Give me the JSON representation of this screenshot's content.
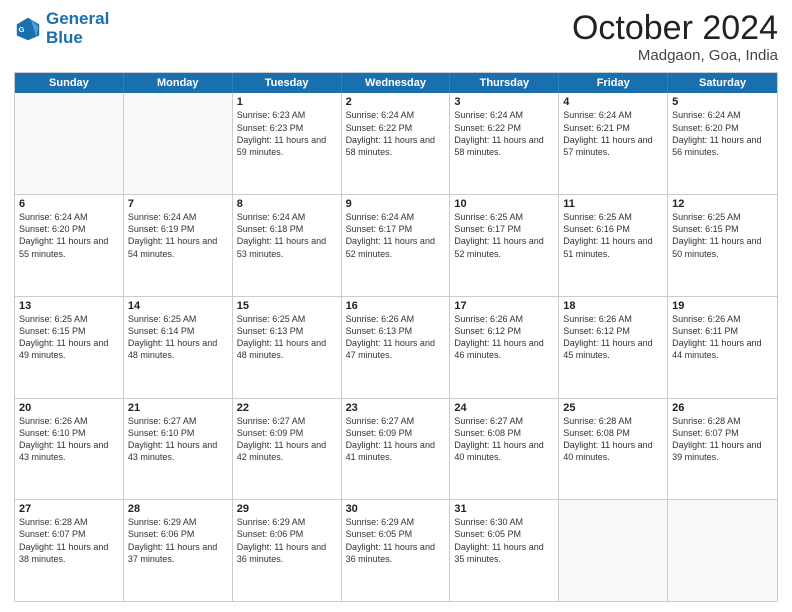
{
  "header": {
    "logo_line1": "General",
    "logo_line2": "Blue",
    "month_title": "October 2024",
    "subtitle": "Madgaon, Goa, India"
  },
  "weekdays": [
    "Sunday",
    "Monday",
    "Tuesday",
    "Wednesday",
    "Thursday",
    "Friday",
    "Saturday"
  ],
  "rows": [
    [
      {
        "day": "",
        "sunrise": "",
        "sunset": "",
        "daylight": ""
      },
      {
        "day": "",
        "sunrise": "",
        "sunset": "",
        "daylight": ""
      },
      {
        "day": "1",
        "sunrise": "Sunrise: 6:23 AM",
        "sunset": "Sunset: 6:23 PM",
        "daylight": "Daylight: 11 hours and 59 minutes."
      },
      {
        "day": "2",
        "sunrise": "Sunrise: 6:24 AM",
        "sunset": "Sunset: 6:22 PM",
        "daylight": "Daylight: 11 hours and 58 minutes."
      },
      {
        "day": "3",
        "sunrise": "Sunrise: 6:24 AM",
        "sunset": "Sunset: 6:22 PM",
        "daylight": "Daylight: 11 hours and 58 minutes."
      },
      {
        "day": "4",
        "sunrise": "Sunrise: 6:24 AM",
        "sunset": "Sunset: 6:21 PM",
        "daylight": "Daylight: 11 hours and 57 minutes."
      },
      {
        "day": "5",
        "sunrise": "Sunrise: 6:24 AM",
        "sunset": "Sunset: 6:20 PM",
        "daylight": "Daylight: 11 hours and 56 minutes."
      }
    ],
    [
      {
        "day": "6",
        "sunrise": "Sunrise: 6:24 AM",
        "sunset": "Sunset: 6:20 PM",
        "daylight": "Daylight: 11 hours and 55 minutes."
      },
      {
        "day": "7",
        "sunrise": "Sunrise: 6:24 AM",
        "sunset": "Sunset: 6:19 PM",
        "daylight": "Daylight: 11 hours and 54 minutes."
      },
      {
        "day": "8",
        "sunrise": "Sunrise: 6:24 AM",
        "sunset": "Sunset: 6:18 PM",
        "daylight": "Daylight: 11 hours and 53 minutes."
      },
      {
        "day": "9",
        "sunrise": "Sunrise: 6:24 AM",
        "sunset": "Sunset: 6:17 PM",
        "daylight": "Daylight: 11 hours and 52 minutes."
      },
      {
        "day": "10",
        "sunrise": "Sunrise: 6:25 AM",
        "sunset": "Sunset: 6:17 PM",
        "daylight": "Daylight: 11 hours and 52 minutes."
      },
      {
        "day": "11",
        "sunrise": "Sunrise: 6:25 AM",
        "sunset": "Sunset: 6:16 PM",
        "daylight": "Daylight: 11 hours and 51 minutes."
      },
      {
        "day": "12",
        "sunrise": "Sunrise: 6:25 AM",
        "sunset": "Sunset: 6:15 PM",
        "daylight": "Daylight: 11 hours and 50 minutes."
      }
    ],
    [
      {
        "day": "13",
        "sunrise": "Sunrise: 6:25 AM",
        "sunset": "Sunset: 6:15 PM",
        "daylight": "Daylight: 11 hours and 49 minutes."
      },
      {
        "day": "14",
        "sunrise": "Sunrise: 6:25 AM",
        "sunset": "Sunset: 6:14 PM",
        "daylight": "Daylight: 11 hours and 48 minutes."
      },
      {
        "day": "15",
        "sunrise": "Sunrise: 6:25 AM",
        "sunset": "Sunset: 6:13 PM",
        "daylight": "Daylight: 11 hours and 48 minutes."
      },
      {
        "day": "16",
        "sunrise": "Sunrise: 6:26 AM",
        "sunset": "Sunset: 6:13 PM",
        "daylight": "Daylight: 11 hours and 47 minutes."
      },
      {
        "day": "17",
        "sunrise": "Sunrise: 6:26 AM",
        "sunset": "Sunset: 6:12 PM",
        "daylight": "Daylight: 11 hours and 46 minutes."
      },
      {
        "day": "18",
        "sunrise": "Sunrise: 6:26 AM",
        "sunset": "Sunset: 6:12 PM",
        "daylight": "Daylight: 11 hours and 45 minutes."
      },
      {
        "day": "19",
        "sunrise": "Sunrise: 6:26 AM",
        "sunset": "Sunset: 6:11 PM",
        "daylight": "Daylight: 11 hours and 44 minutes."
      }
    ],
    [
      {
        "day": "20",
        "sunrise": "Sunrise: 6:26 AM",
        "sunset": "Sunset: 6:10 PM",
        "daylight": "Daylight: 11 hours and 43 minutes."
      },
      {
        "day": "21",
        "sunrise": "Sunrise: 6:27 AM",
        "sunset": "Sunset: 6:10 PM",
        "daylight": "Daylight: 11 hours and 43 minutes."
      },
      {
        "day": "22",
        "sunrise": "Sunrise: 6:27 AM",
        "sunset": "Sunset: 6:09 PM",
        "daylight": "Daylight: 11 hours and 42 minutes."
      },
      {
        "day": "23",
        "sunrise": "Sunrise: 6:27 AM",
        "sunset": "Sunset: 6:09 PM",
        "daylight": "Daylight: 11 hours and 41 minutes."
      },
      {
        "day": "24",
        "sunrise": "Sunrise: 6:27 AM",
        "sunset": "Sunset: 6:08 PM",
        "daylight": "Daylight: 11 hours and 40 minutes."
      },
      {
        "day": "25",
        "sunrise": "Sunrise: 6:28 AM",
        "sunset": "Sunset: 6:08 PM",
        "daylight": "Daylight: 11 hours and 40 minutes."
      },
      {
        "day": "26",
        "sunrise": "Sunrise: 6:28 AM",
        "sunset": "Sunset: 6:07 PM",
        "daylight": "Daylight: 11 hours and 39 minutes."
      }
    ],
    [
      {
        "day": "27",
        "sunrise": "Sunrise: 6:28 AM",
        "sunset": "Sunset: 6:07 PM",
        "daylight": "Daylight: 11 hours and 38 minutes."
      },
      {
        "day": "28",
        "sunrise": "Sunrise: 6:29 AM",
        "sunset": "Sunset: 6:06 PM",
        "daylight": "Daylight: 11 hours and 37 minutes."
      },
      {
        "day": "29",
        "sunrise": "Sunrise: 6:29 AM",
        "sunset": "Sunset: 6:06 PM",
        "daylight": "Daylight: 11 hours and 36 minutes."
      },
      {
        "day": "30",
        "sunrise": "Sunrise: 6:29 AM",
        "sunset": "Sunset: 6:05 PM",
        "daylight": "Daylight: 11 hours and 36 minutes."
      },
      {
        "day": "31",
        "sunrise": "Sunrise: 6:30 AM",
        "sunset": "Sunset: 6:05 PM",
        "daylight": "Daylight: 11 hours and 35 minutes."
      },
      {
        "day": "",
        "sunrise": "",
        "sunset": "",
        "daylight": ""
      },
      {
        "day": "",
        "sunrise": "",
        "sunset": "",
        "daylight": ""
      }
    ]
  ]
}
